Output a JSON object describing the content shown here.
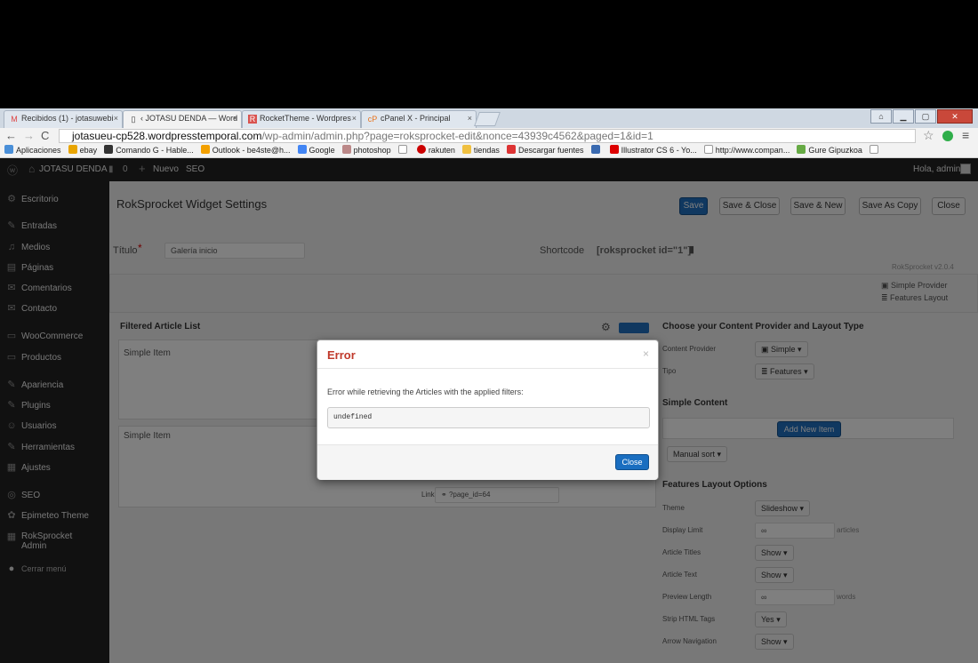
{
  "browser": {
    "tabs": [
      {
        "icon": "M",
        "label": "Recibidos (1) - jotasuwebi"
      },
      {
        "icon": "▯",
        "label": "‹ JOTASU DENDA — Word"
      },
      {
        "icon": "R",
        "label": "RocketTheme - Wordpres"
      },
      {
        "icon": "cP",
        "label": "cPanel X - Principal"
      }
    ],
    "url_host": "jotasueu-cp528.wordpresstemporal.com",
    "url_path": "/wp-admin/admin.php?page=roksprocket-edit&nonce=43939c4562&paged=1&id=1",
    "bookmarks": [
      "Aplicaciones",
      "ebay",
      "Comando G - Hable...",
      "Outlook - be4ste@h...",
      "Google",
      "photoshop",
      "",
      "rakuten",
      "tiendas",
      "Descargar fuentes",
      "",
      "Illustrator CS 6 - Yo...",
      "http://www.compan...",
      "Gure Gipuzkoa",
      ""
    ]
  },
  "adminbar": {
    "site": "JOTASU DENDA",
    "comments": "0",
    "new": "Nuevo",
    "seo": "SEO",
    "greeting": "Hola, admin"
  },
  "sidebar": {
    "items": [
      {
        "icon": "⚙",
        "label": "Escritorio"
      },
      {
        "icon": "✎",
        "label": "Entradas"
      },
      {
        "icon": "♫",
        "label": "Medios"
      },
      {
        "icon": "▤",
        "label": "Páginas"
      },
      {
        "icon": "✉",
        "label": "Comentarios"
      },
      {
        "icon": "✉",
        "label": "Contacto"
      },
      {
        "icon": "▭",
        "label": "WooCommerce"
      },
      {
        "icon": "▭",
        "label": "Productos"
      },
      {
        "icon": "✎",
        "label": "Apariencia"
      },
      {
        "icon": "✎",
        "label": "Plugins"
      },
      {
        "icon": "☺",
        "label": "Usuarios"
      },
      {
        "icon": "✎",
        "label": "Herramientas"
      },
      {
        "icon": "▦",
        "label": "Ajustes"
      },
      {
        "icon": "◎",
        "label": "SEO"
      },
      {
        "icon": "✿",
        "label": "Epimeteo Theme"
      },
      {
        "icon": "▦",
        "label": "RokSprocket Admin"
      },
      {
        "icon": "●",
        "label": "Cerrar menú"
      }
    ]
  },
  "page": {
    "title": "RokSprocket Widget Settings",
    "buttons": {
      "save": "Save",
      "save_close": "Save & Close",
      "save_new": "Save & New",
      "save_copy": "Save As Copy",
      "close": "Close"
    },
    "titulo_label": "Título",
    "titulo_value": "Galería inicio",
    "shortcode_label": "Shortcode",
    "shortcode_value": "[roksprocket id=\"1\"]",
    "version": "RokSprocket v2.0.4",
    "provider_simple": "Simple Provider",
    "provider_features": "Features Layout",
    "filtered_list": "Filtered Article List",
    "simple_item": "Simple Item",
    "link_label": "Link",
    "link_value": "?page_id=64",
    "choose_header": "Choose your Content Provider and Layout Type",
    "content_provider_label": "Content Provider",
    "content_provider_value": "Simple",
    "tipo_label": "Tipo",
    "tipo_value": "Features",
    "simple_content": "Simple Content",
    "add_new_item": "Add New Item",
    "manual_sort": "Manual sort",
    "features_header": "Features Layout Options",
    "options": [
      {
        "label": "Theme",
        "value": "Slideshow"
      },
      {
        "label": "Display Limit",
        "value": "∞",
        "suffix": "articles"
      },
      {
        "label": "Article Titles",
        "value": "Show"
      },
      {
        "label": "Article Text",
        "value": "Show"
      },
      {
        "label": "Preview Length",
        "value": "∞",
        "suffix": "words"
      },
      {
        "label": "Strip HTML Tags",
        "value": "Yes"
      },
      {
        "label": "Arrow Navigation",
        "value": "Show"
      }
    ]
  },
  "modal": {
    "title": "Error",
    "message": "Error while retrieving the Articles with the applied filters:",
    "code": "undefined",
    "close_label": "Close"
  }
}
